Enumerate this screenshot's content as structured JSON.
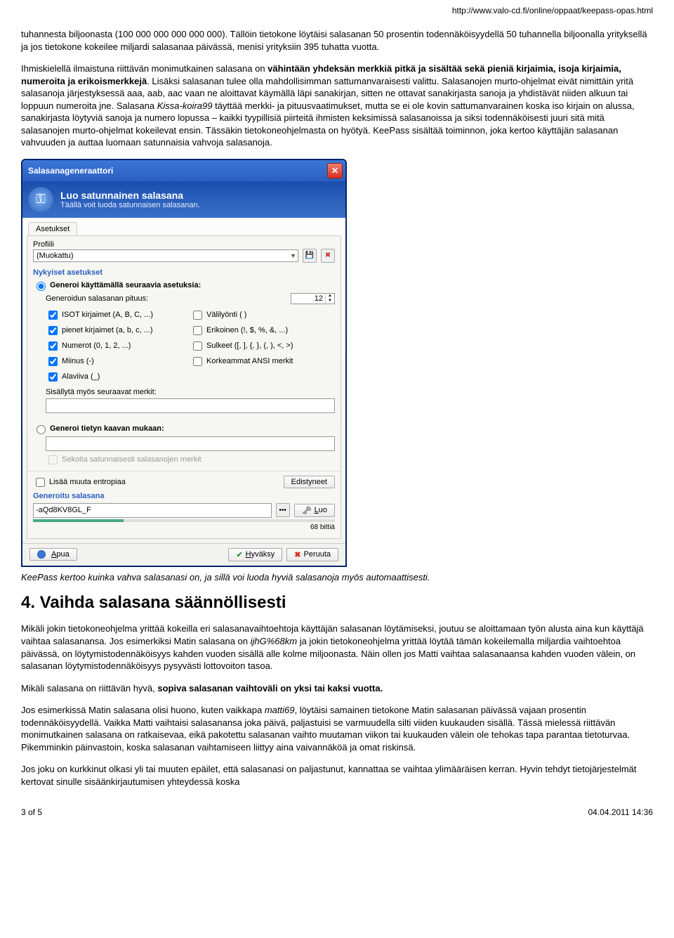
{
  "url": "http://www.valo-cd.fi/online/oppaat/keepass-opas.html",
  "para1_a": "tuhannesta biljoonasta (100 000 000 000 000 000). Tällöin tietokone löytäisi salasanan 50 prosentin todennäköisyydellä 50 tuhannella biljoonalla yrityksellä ja jos tietokone kokeilee miljardi salasanaa päivässä, menisi yrityksiin 395 tuhatta vuotta.",
  "para2_a": "Ihmiskielellä ilmaistuna riittävän monimutkainen salasana on ",
  "para2_b": "vähintään yhdeksän merkkiä pitkä ja sisältää sekä pieniä kirjaimia, isoja kirjaimia, numeroita ja erikoismerkkejä",
  "para2_c": ". Lisäksi salasanan tulee olla mahdollisimman sattumanvaraisesti valittu. Salasanojen murto-ohjelmat eivät nimittäin yritä salasanoja järjestyksessä aaa, aab, aac vaan ne aloittavat käymällä läpi sanakirjan, sitten ne ottavat sanakirjasta sanoja ja yhdistävät niiden alkuun tai loppuun numeroita jne. Salasana ",
  "para2_d": "Kissa-koira99",
  "para2_e": " täyttää merkki- ja pituusvaatimukset, mutta se ei ole kovin sattumanvarainen koska iso kirjain on alussa, sanakirjasta löytyviä sanoja ja numero lopussa – kaikki tyypillisiä piirteitä ihmisten keksimissä salasanoissa ja siksi todennäköisesti juuri sitä mitä salasanojen murto-ohjelmat kokeilevat ensin. Tässäkin tietokoneohjelmasta on hyötyä. KeePass sisältää toiminnon, joka kertoo käyttäjän salasanan vahvuuden ja auttaa luomaan satunnaisia vahvoja salasanoja.",
  "dialog": {
    "title": "Salasanageneraattori",
    "banner_title": "Luo satunnainen salasana",
    "banner_sub": "Täällä voit luoda satunnaisen salasanan.",
    "tab": "Asetukset",
    "profile_label": "Profiili",
    "profile_value": "(Muokattu)",
    "current_settings": "Nykyiset asetukset",
    "opt1": "Generoi käyttämällä seuraavia asetuksia:",
    "len_label": "Generoidun salasanan pituus:",
    "len_value": "12",
    "chk_upper": "ISOT kirjaimet (A, B, C, ...)",
    "chk_lower": "pienet kirjaimet (a, b, c, ...)",
    "chk_digits": "Numerot (0, 1, 2, ...)",
    "chk_minus": "Miinus (-)",
    "chk_under": "Alaviiva (_)",
    "chk_space": "Välilyönti ( )",
    "chk_special": "Erikoinen (!, $, %, &, ...)",
    "chk_brackets": "Sulkeet ([, ], {, }, (, ), <, >)",
    "chk_ansi": "Korkeammat ANSI merkit",
    "also_label": "Sisällytä myös seuraavat merkit:",
    "opt2": "Generoi tietyn kaavan mukaan:",
    "shuffle": "Sekoita satunnaisesti salasanojen merkit",
    "entropy": "Lisää muuta entropiaa",
    "advanced": "Edistyneet",
    "gen_title": "Generoitu salasana",
    "gen_value": "-aQd8KV8GL_F",
    "bits": "68 bittiä",
    "btn_gen": "Luo",
    "btn_help": "Apua",
    "btn_ok": "Hyväksy",
    "btn_cancel": "Peruuta"
  },
  "caption": "KeePass kertoo kuinka vahva salasanasi on, ja sillä voi luoda hyviä salasanoja myös automaattisesti.",
  "heading4": "4. Vaihda salasana säännöllisesti",
  "p4a_a": "Mikäli jokin tietokoneohjelma yrittää kokeilla eri salasanavaihtoehtoja käyttäjän salasanan löytämiseksi, joutuu se aloittamaan työn alusta aina kun käyttäjä vaihtaa salasanansa. Jos esimerkiksi Matin salasana on ",
  "p4a_b": "ijhG%68km",
  "p4a_c": " ja jokin tietokoneohjelma yrittää löytää tämän kokeilemalla miljardia vaihtoehtoa päivässä, on löytymistodennäköisyys kahden vuoden sisällä alle kolme miljoonasta. Näin ollen jos Matti vaihtaa salasanaansa kahden vuoden välein, on salasanan löytymistodennäköisyys pysyvästi lottovoiton tasoa.",
  "p4b_a": "Mikäli salasana on riittävän hyvä, ",
  "p4b_b": "sopiva salasanan vaihtoväli on yksi tai kaksi vuotta.",
  "p4c_a": "Jos esimerkissä Matin salasana olisi huono, kuten vaikkapa ",
  "p4c_b": "matti69",
  "p4c_c": ", löytäisi samainen tietokone Matin salasanan päivässä vajaan prosentin todennäköisyydellä. Vaikka Matti vaihtaisi salasanansa joka päivä, paljastuisi se varmuudella silti viiden kuukauden sisällä. Tässä mielessä riittävän monimutkainen salasana on ratkaisevaa, eikä pakotettu salasanan vaihto muutaman viikon tai kuukauden välein ole tehokas tapa parantaa tietoturvaa. Pikemminkin päinvastoin, koska salasanan vaihtamiseen liittyy aina vaivannäköä ja omat riskinsä.",
  "p4d": "Jos joku on kurkkinut olkasi yli tai muuten epäilet, että salasanasi on paljastunut, kannattaa se vaihtaa ylimääräisen kerran. Hyvin tehdyt tietojärjestelmät kertovat sinulle sisäänkirjautumisen yhteydessä koska",
  "footer_left": "3 of 5",
  "footer_right": "04.04.2011 14:36"
}
